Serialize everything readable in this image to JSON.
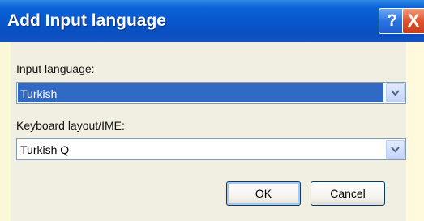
{
  "window": {
    "title": "Add Input language",
    "help_glyph": "?",
    "close_glyph": "X"
  },
  "input_language": {
    "label": "Input language:",
    "value": "Turkish"
  },
  "keyboard_layout": {
    "label": "Keyboard layout/IME:",
    "value": "Turkish Q"
  },
  "buttons": {
    "ok": "OK",
    "cancel": "Cancel"
  },
  "icons": {
    "help": "help-icon",
    "close": "close-icon",
    "dropdown": "chevron-down-icon"
  },
  "colors": {
    "title_bar": "#0758cc",
    "selection": "#316ac5",
    "dialog_face": "#f1efe2",
    "close_button": "#e2542f"
  }
}
